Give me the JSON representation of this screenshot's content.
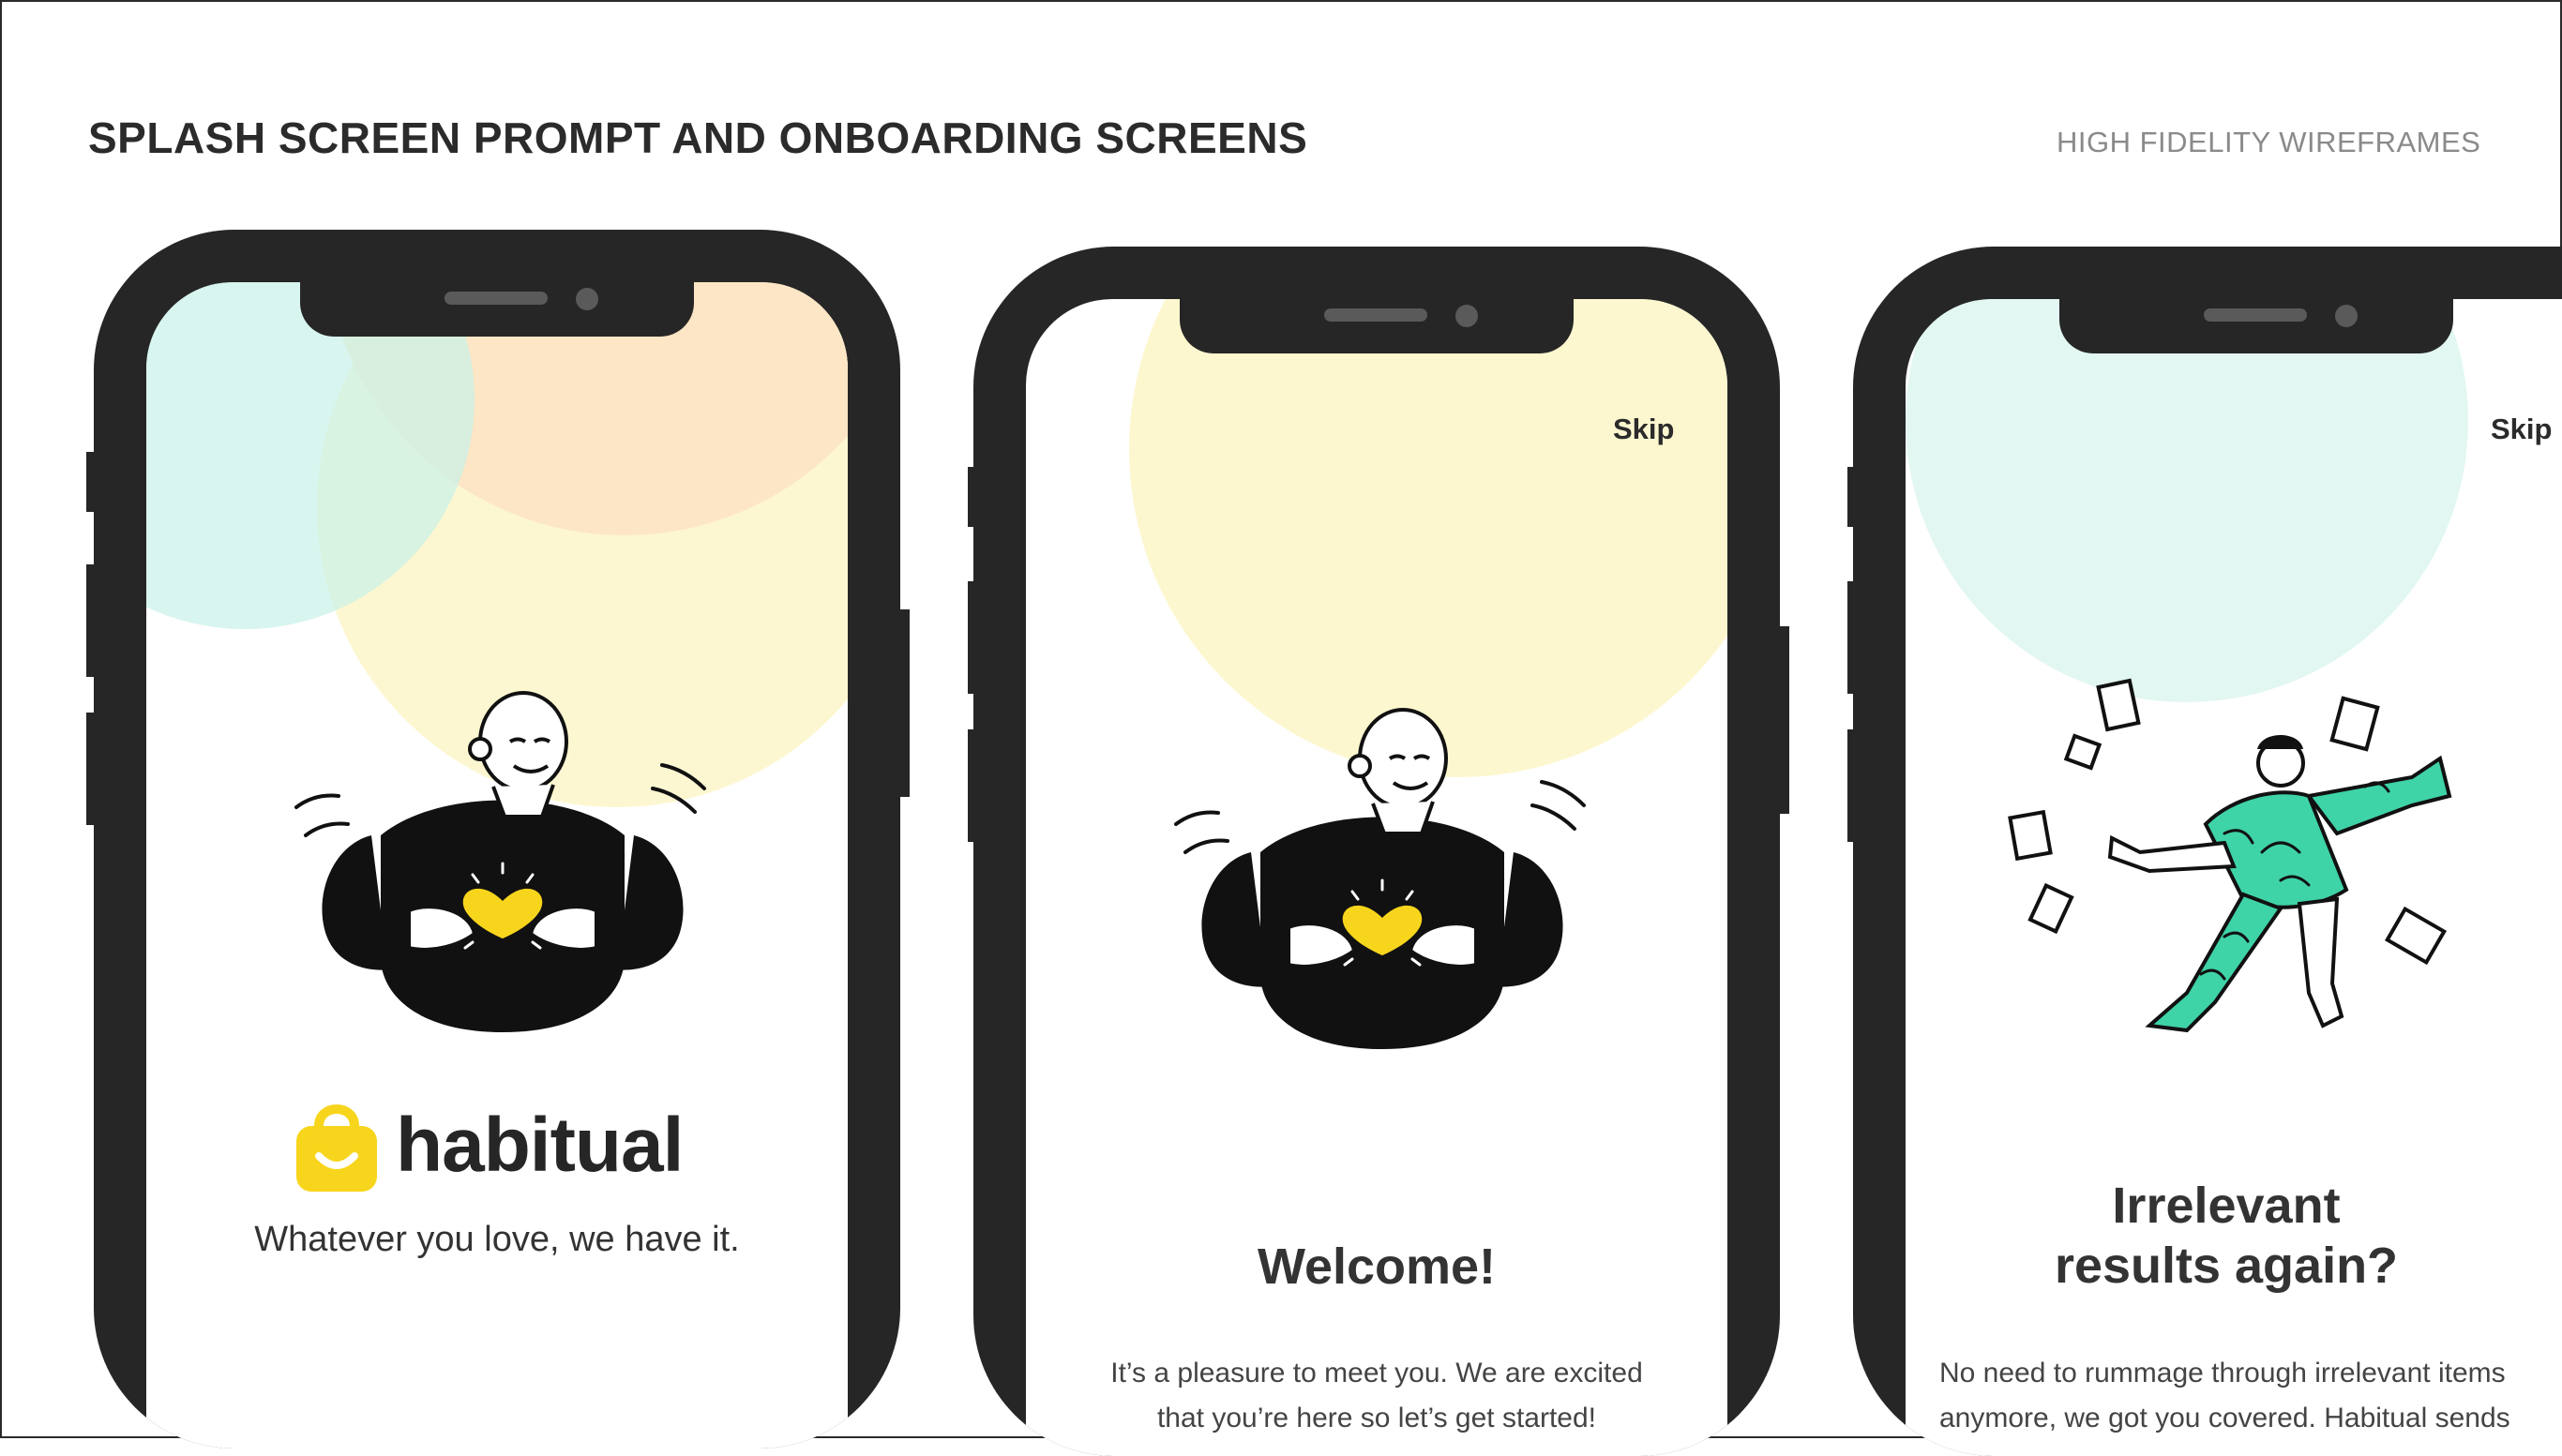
{
  "header": {
    "title": "SPLASH SCREEN PROMPT AND ONBOARDING SCREENS",
    "tag": "HIGH FIDELITY WIREFRAMES"
  },
  "colors": {
    "phone_frame": "#262626",
    "mint": "#d5f5ef",
    "peach": "#fde3c4",
    "pale_yellow": "#fdf7cf",
    "heart_yellow": "#f7d51d",
    "accent_green": "#3fd3a8"
  },
  "screens": {
    "splash": {
      "brand_name": "habitual",
      "brand_icon": "shopping-bag-smile-icon",
      "tagline": "Whatever you love, we have it."
    },
    "welcome": {
      "skip_label": "Skip",
      "title": "Welcome!",
      "body_line1": "It’s a pleasure to meet you. We are excited",
      "body_line2": "that you’re here so let’s get started!"
    },
    "irrelevant": {
      "skip_label": "Skip",
      "title_line1": "Irrelevant",
      "title_line2": "results again?",
      "body_line1": "No need to rummage through irrelevant items",
      "body_line2": "anymore, we got you covered. Habitual sends"
    }
  }
}
